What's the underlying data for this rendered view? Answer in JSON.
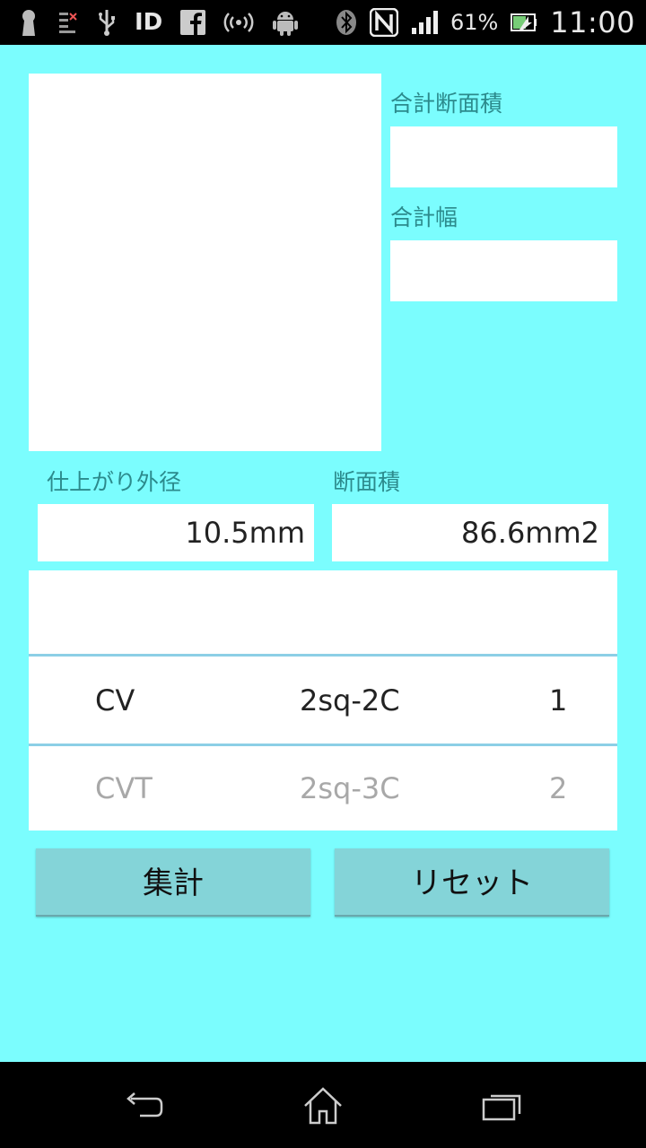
{
  "status_bar": {
    "battery_percent": "61%",
    "time": "11:00",
    "id_text": "ID",
    "icons": [
      "keyhole-icon",
      "sim-card-icon",
      "usb-icon",
      "id-icon",
      "facebook-icon",
      "hotspot-icon",
      "android-icon",
      "bluetooth-icon",
      "nfc-icon",
      "signal-icon",
      "battery-icon"
    ]
  },
  "summary": {
    "total_area_label": "合計断面積",
    "total_area_value": "",
    "total_width_label": "合計幅",
    "total_width_value": ""
  },
  "cable": {
    "outer_diameter_label": "仕上がり外径",
    "outer_diameter_value": "10.5mm",
    "area_label": "断面積",
    "area_value": "86.6mm2"
  },
  "picker": {
    "rows": [
      {
        "type": "",
        "size": "",
        "count": ""
      },
      {
        "type": "CV",
        "size": "2sq-2C",
        "count": "1"
      },
      {
        "type": "CVT",
        "size": "2sq-3C",
        "count": "2"
      }
    ]
  },
  "buttons": {
    "sum_label": "集計",
    "reset_label": "リセット"
  },
  "nav": {
    "icons": [
      "back-icon",
      "home-icon",
      "recent-apps-icon"
    ]
  }
}
